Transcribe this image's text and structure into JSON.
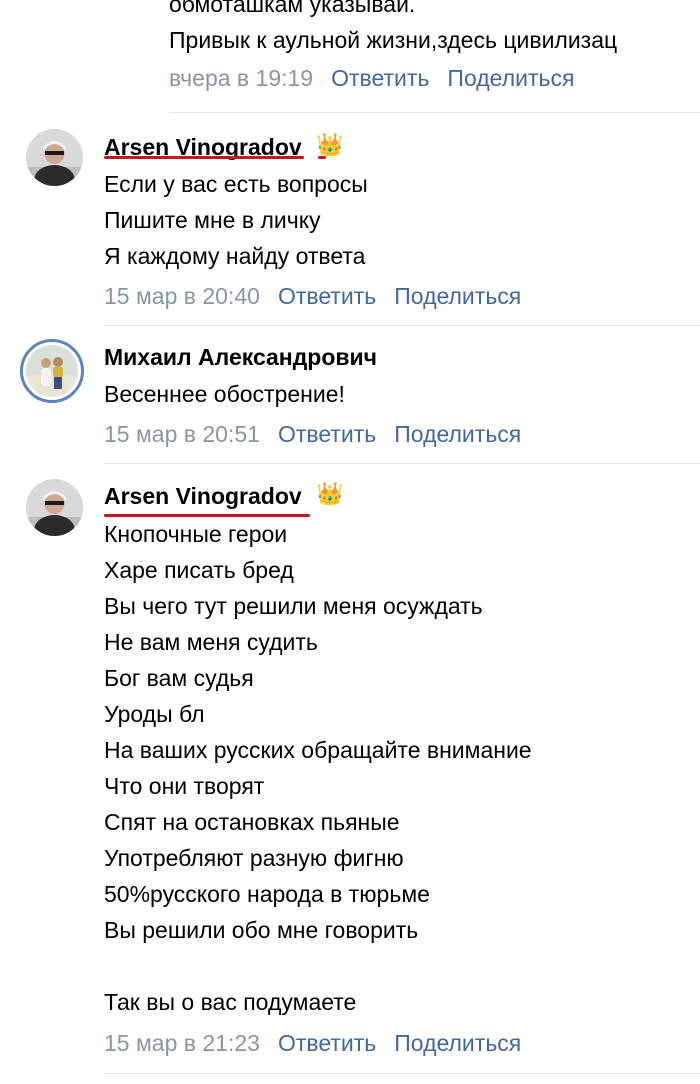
{
  "top_comment": {
    "lines": [
      "обмоташкам указывай.",
      "Привык к аульной жизни,здесь цивилизац"
    ],
    "date": "вчера в 19:19"
  },
  "actions": {
    "reply": "Ответить",
    "share": "Поделиться"
  },
  "comments": [
    {
      "author": "Arsen Vinogradov",
      "badge": "crown-icon",
      "lines": [
        "Если у вас есть вопросы",
        "Пишите мне в личку",
        "Я каждому найду ответа"
      ],
      "date": "15 мар в 20:40"
    },
    {
      "author": "Михаил Александрович",
      "lines": [
        "Весеннее обострение!"
      ],
      "date": "15 мар в 20:51"
    },
    {
      "author": "Arsen Vinogradov",
      "badge": "crown-icon",
      "lines": [
        "Кнопочные герои",
        "Харе писать бред",
        "Вы чего тут решили меня осуждать",
        "Не вам меня судить",
        "Бог вам судья",
        "Уроды бл",
        "На ваших русских обращайте внимание",
        "Что они творят",
        "Спят на остановках пьяные",
        "Употребляют разную фигню",
        "50%русского народа в тюрьме",
        "Вы решили обо мне говорить",
        "",
        "Так вы о вас подумаете"
      ],
      "date": "15 мар в 21:23"
    }
  ],
  "colors": {
    "link": "#41699b",
    "date": "#8a94a3",
    "underline": "#c8141e",
    "divider": "#e1e4e8"
  }
}
